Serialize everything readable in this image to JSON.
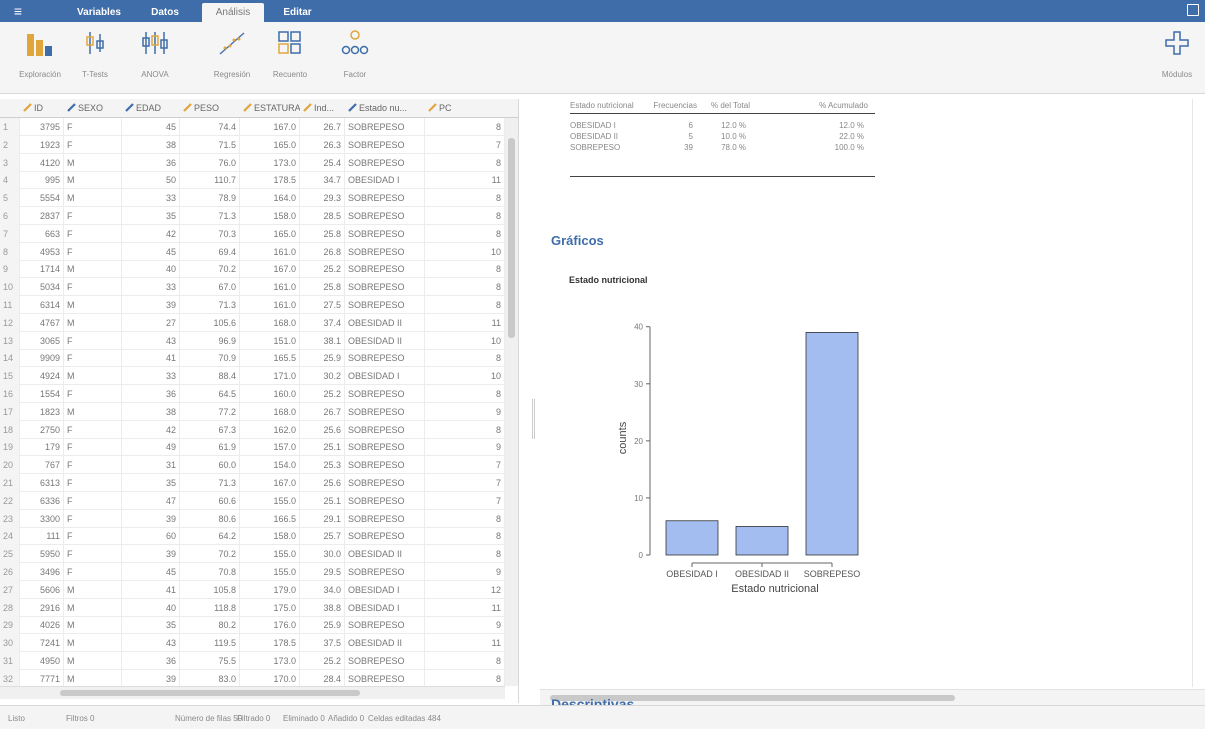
{
  "menubar": {
    "tabs": [
      {
        "label": "Variables",
        "active": false
      },
      {
        "label": "Datos",
        "active": false
      },
      {
        "label": "Análisis",
        "active": true
      },
      {
        "label": "Editar",
        "active": false
      }
    ]
  },
  "ribbon": {
    "buttons": [
      {
        "label": "Exploración",
        "icon": "exploration-icon"
      },
      {
        "label": "T-Tests",
        "icon": "t-tests-icon"
      },
      {
        "label": "ANOVA",
        "icon": "anova-icon"
      },
      {
        "label": "Regresión",
        "icon": "regression-icon"
      },
      {
        "label": "Recuento",
        "icon": "frequencies-icon"
      },
      {
        "label": "Factor",
        "icon": "factor-icon"
      }
    ],
    "modules_label": "Módulos"
  },
  "grid": {
    "columns": [
      "ID",
      "SEXO",
      "EDAD",
      "PESO",
      "ESTATURA",
      "Ind...",
      "Estado nu...",
      "PC"
    ],
    "rows": [
      [
        "1",
        "3795",
        "F",
        "45",
        "74.4",
        "167.0",
        "26.7",
        "SOBREPESO",
        "8"
      ],
      [
        "2",
        "1923",
        "F",
        "38",
        "71.5",
        "165.0",
        "26.3",
        "SOBREPESO",
        "7"
      ],
      [
        "3",
        "4120",
        "M",
        "36",
        "76.0",
        "173.0",
        "25.4",
        "SOBREPESO",
        "8"
      ],
      [
        "4",
        "995",
        "M",
        "50",
        "110.7",
        "178.5",
        "34.7",
        "OBESIDAD I",
        "11"
      ],
      [
        "5",
        "5554",
        "M",
        "33",
        "78.9",
        "164.0",
        "29.3",
        "SOBREPESO",
        "8"
      ],
      [
        "6",
        "2837",
        "F",
        "35",
        "71.3",
        "158.0",
        "28.5",
        "SOBREPESO",
        "8"
      ],
      [
        "7",
        "663",
        "F",
        "42",
        "70.3",
        "165.0",
        "25.8",
        "SOBREPESO",
        "8"
      ],
      [
        "8",
        "4953",
        "F",
        "45",
        "69.4",
        "161.0",
        "26.8",
        "SOBREPESO",
        "10"
      ],
      [
        "9",
        "1714",
        "M",
        "40",
        "70.2",
        "167.0",
        "25.2",
        "SOBREPESO",
        "8"
      ],
      [
        "10",
        "5034",
        "F",
        "33",
        "67.0",
        "161.0",
        "25.8",
        "SOBREPESO",
        "8"
      ],
      [
        "11",
        "6314",
        "M",
        "39",
        "71.3",
        "161.0",
        "27.5",
        "SOBREPESO",
        "8"
      ],
      [
        "12",
        "4767",
        "M",
        "27",
        "105.6",
        "168.0",
        "37.4",
        "OBESIDAD II",
        "11"
      ],
      [
        "13",
        "3065",
        "F",
        "43",
        "96.9",
        "151.0",
        "38.1",
        "OBESIDAD II",
        "10"
      ],
      [
        "14",
        "9909",
        "F",
        "41",
        "70.9",
        "165.5",
        "25.9",
        "SOBREPESO",
        "8"
      ],
      [
        "15",
        "4924",
        "M",
        "33",
        "88.4",
        "171.0",
        "30.2",
        "OBESIDAD I",
        "10"
      ],
      [
        "16",
        "1554",
        "F",
        "36",
        "64.5",
        "160.0",
        "25.2",
        "SOBREPESO",
        "8"
      ],
      [
        "17",
        "1823",
        "M",
        "38",
        "77.2",
        "168.0",
        "26.7",
        "SOBREPESO",
        "9"
      ],
      [
        "18",
        "2750",
        "F",
        "42",
        "67.3",
        "162.0",
        "25.6",
        "SOBREPESO",
        "8"
      ],
      [
        "19",
        "179",
        "F",
        "49",
        "61.9",
        "157.0",
        "25.1",
        "SOBREPESO",
        "9"
      ],
      [
        "20",
        "767",
        "F",
        "31",
        "60.0",
        "154.0",
        "25.3",
        "SOBREPESO",
        "7"
      ],
      [
        "21",
        "6313",
        "F",
        "35",
        "71.3",
        "167.0",
        "25.6",
        "SOBREPESO",
        "7"
      ],
      [
        "22",
        "6336",
        "F",
        "47",
        "60.6",
        "155.0",
        "25.1",
        "SOBREPESO",
        "7"
      ],
      [
        "23",
        "3300",
        "F",
        "39",
        "80.6",
        "166.5",
        "29.1",
        "SOBREPESO",
        "8"
      ],
      [
        "24",
        "111",
        "F",
        "60",
        "64.2",
        "158.0",
        "25.7",
        "SOBREPESO",
        "8"
      ],
      [
        "25",
        "5950",
        "F",
        "39",
        "70.2",
        "155.0",
        "30.0",
        "OBESIDAD II",
        "8"
      ],
      [
        "26",
        "3496",
        "F",
        "45",
        "70.8",
        "155.0",
        "29.5",
        "SOBREPESO",
        "9"
      ],
      [
        "27",
        "5606",
        "M",
        "41",
        "105.8",
        "179.0",
        "34.0",
        "OBESIDAD I",
        "12"
      ],
      [
        "28",
        "2916",
        "M",
        "40",
        "118.8",
        "175.0",
        "38.8",
        "OBESIDAD I",
        "11"
      ],
      [
        "29",
        "4026",
        "M",
        "35",
        "80.2",
        "176.0",
        "25.9",
        "SOBREPESO",
        "9"
      ],
      [
        "30",
        "7241",
        "M",
        "43",
        "119.5",
        "178.5",
        "37.5",
        "OBESIDAD II",
        "11"
      ],
      [
        "31",
        "4950",
        "M",
        "36",
        "75.5",
        "173.0",
        "25.2",
        "SOBREPESO",
        "8"
      ],
      [
        "32",
        "7771",
        "M",
        "39",
        "83.0",
        "170.0",
        "28.4",
        "SOBREPESO",
        "8"
      ]
    ]
  },
  "statusbar": {
    "items": [
      "Listo",
      "Filtros 0",
      "Número de filas 50",
      "Filtrado 0",
      "Eliminado 0",
      "Añadido 0",
      "Celdas editadas 484"
    ]
  },
  "freq_table": {
    "headers": [
      "Estado nutricional",
      "Frecuencias",
      "% del Total",
      "% Acumulado"
    ],
    "rows": [
      [
        "OBESIDAD I",
        "6",
        "12.0 %",
        "12.0 %"
      ],
      [
        "OBESIDAD II",
        "5",
        "10.0 %",
        "22.0 %"
      ],
      [
        "SOBREPESO",
        "39",
        "78.0 %",
        "100.0 %"
      ]
    ]
  },
  "section_graficos": "Gráficos",
  "chart_title": "Estado nutricional",
  "section_descriptivas": "Descriptivas",
  "chart_data": {
    "type": "bar",
    "title": "Estado nutricional",
    "categories": [
      "OBESIDAD I",
      "OBESIDAD II",
      "SOBREPESO"
    ],
    "values": [
      6,
      5,
      39
    ],
    "xlabel": "Estado nutricional",
    "ylabel": "counts",
    "yticks": [
      0,
      10,
      20,
      30,
      40
    ],
    "ylim": [
      0,
      40
    ],
    "bar_color": "#a3bdf0",
    "grid": false
  },
  "colors": {
    "accent": "#3e6da9",
    "bar": "#a3bdf0"
  }
}
